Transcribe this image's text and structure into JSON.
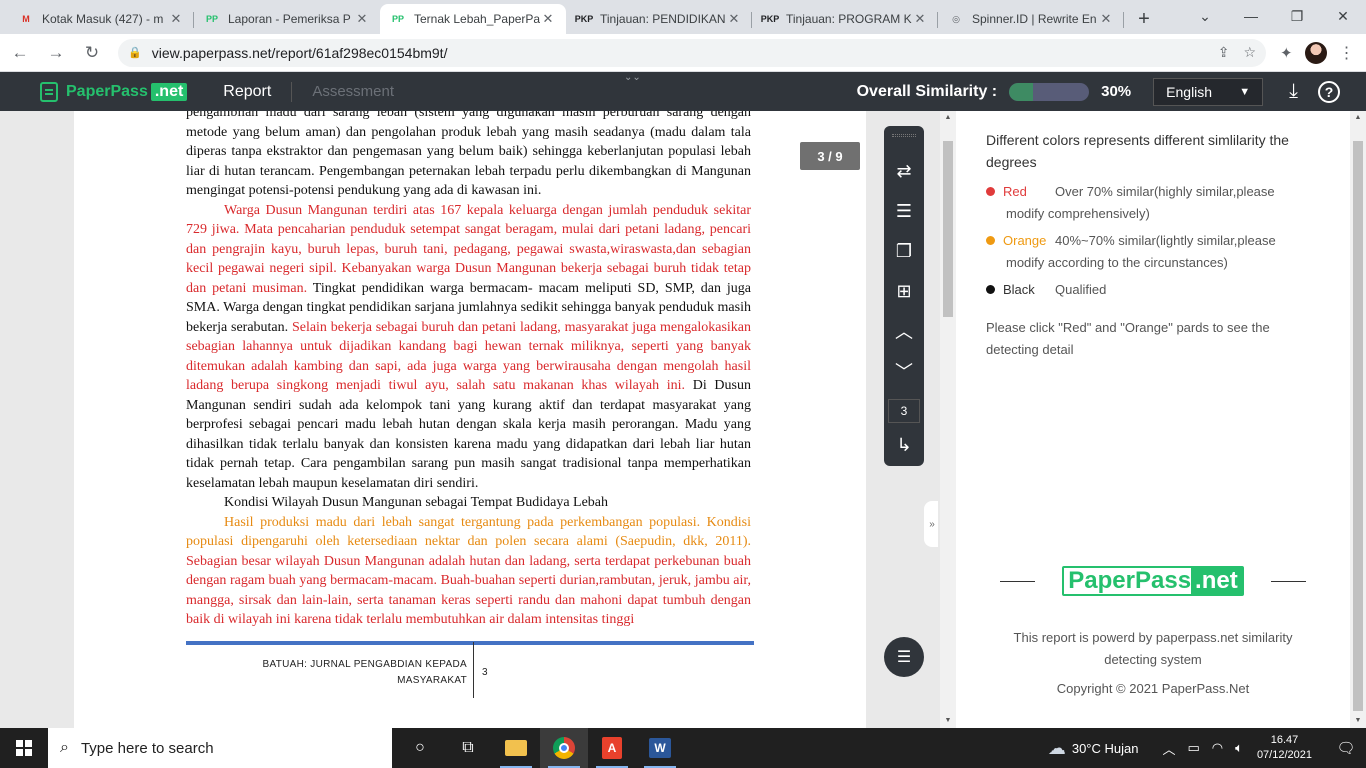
{
  "tabs": [
    {
      "icon": "M",
      "icon_color": "#d93025",
      "title": "Kotak Masuk (427) - m",
      "active": false
    },
    {
      "icon": "PP",
      "icon_color": "#25c06d",
      "title": "Laporan - Pemeriksa P",
      "active": false
    },
    {
      "icon": "PP",
      "icon_color": "#25c06d",
      "title": "Ternak Lebah_PaperPa",
      "active": true
    },
    {
      "icon": "PKP",
      "icon_color": "#202124",
      "title": "Tinjauan: PENDIDIKAN",
      "active": false
    },
    {
      "icon": "PKP",
      "icon_color": "#202124",
      "title": "Tinjauan: PROGRAM K",
      "active": false
    },
    {
      "icon": "◎",
      "icon_color": "#5f6368",
      "title": "Spinner.ID | Rewrite En",
      "active": false
    }
  ],
  "browser": {
    "url": "view.paperpass.net/report/61af298ec0154bm9t/"
  },
  "app": {
    "logo_text": "PaperPass",
    "logo_net": ".net",
    "nav_report": "Report",
    "nav_assessment": "Assessment",
    "overall_label": "Overall Similarity :",
    "similarity_pct": "30%",
    "similarity_value": 0.3,
    "language": "English"
  },
  "document": {
    "page_badge": "3 / 9",
    "p1_black_a": "pengambilan madu dari sarang lebah (sistem yang digunakan masih perburuan sarang dengan metode yang belum aman) dan pengolahan produk lebah yang masih seadanya (madu dalam tala diperas tanpa ekstraktor dan pengemasan yang belum baik) sehingga keberlanjutan populasi lebah liar di hutan terancam. Pengembangan peternakan lebah terpadu perlu dikembangkan di Mangunan mengingat potensi-potensi pendukung yang ada di kawasan ini.",
    "p2_red_a": "Warga Dusun Mangunan terdiri atas 167 kepala keluarga dengan jumlah penduduk sekitar 729 jiwa. Mata pencaharian penduduk setempat sangat beragam, mulai dari petani ladang, pencari dan pengrajin kayu, buruh lepas, buruh tani, pedagang, pegawai swasta,wiraswasta,dan sebagian kecil pegawai negeri sipil. Kebanyakan warga Dusun Mangunan bekerja sebagai buruh tidak tetap dan petani musiman.",
    "p2_black_b": " Tingkat pendidikan warga bermacam- macam meliputi SD, SMP, dan juga SMA. Warga dengan tingkat pendidikan sarjana jumlahnya sedikit sehingga banyak penduduk masih bekerja serabutan.",
    "p2_red_c": " Selain bekerja sebagai buruh dan petani ladang, masyarakat juga mengalokasikan sebagian lahannya untuk dijadikan kandang bagi hewan ternak miliknya, seperti yang banyak ditemukan adalah kambing dan sapi, ada juga warga yang berwirausaha dengan mengolah hasil ladang berupa singkong menjadi tiwul ayu, salah satu makanan khas wilayah ini.",
    "p2_black_d": " Di Dusun Mangunan sendiri sudah ada kelompok tani yang kurang aktif dan terdapat masyarakat yang berprofesi sebagai pencari madu lebah hutan dengan skala kerja masih perorangan. Madu yang dihasilkan tidak terlalu banyak dan konsisten karena madu yang didapatkan dari lebah liar hutan tidak pernah tetap. Cara pengambilan sarang pun masih sangat tradisional tanpa memperhatikan keselamatan lebah maupun keselamatan diri sendiri.",
    "subheading": "Kondisi Wilayah Dusun Mangunan sebagai Tempat Budidaya Lebah",
    "p3_orange_a": "Hasil produksi madu dari lebah sangat tergantung pada perkembangan populasi. Kondisi populasi dipengaruhi oleh ketersediaan nektar dan polen secara alami (Saepudin, dkk, 2011).",
    "p3_red_b": " Sebagian besar wilayah Dusun Mangunan adalah hutan dan ladang, serta terdapat perkebunan buah dengan ragam buah yang bermacam-macam. Buah-buahan seperti durian,rambutan, jeruk, jambu air, mangga, sirsak dan lain-lain, serta tanaman keras seperti randu dan mahoni dapat tumbuh dengan baik di wilayah ini karena tidak terlalu membutuhkan air dalam intensitas tinggi",
    "footer_journal_1": "BATUAH: JURNAL PENGABDIAN KEPADA",
    "footer_journal_2": "MASYARAKAT",
    "footer_page": "3"
  },
  "toolbar": {
    "page_input": "3"
  },
  "panel": {
    "title": "Different colors represents different simlilarity the degrees",
    "legend": [
      {
        "name": "Red",
        "color": "#e03b3b",
        "desc": "Over 70% similar(highly similar,please",
        "desc2": "modify comprehensively)"
      },
      {
        "name": "Orange",
        "color": "#ef9a12",
        "desc": "40%~70% similar(lightly similar,please",
        "desc2": "modify according to the circunstances)"
      },
      {
        "name": "Black",
        "color": "#111111",
        "desc": "Qualified",
        "desc2": ""
      }
    ],
    "click_hint": "Please click \"Red\" and \"Orange\" pards to see the detecting detail",
    "logo_text": "PaperPass",
    "logo_net": ".net",
    "powered": "This report is powerd by paperpass.net similarity detecting system",
    "copyright": "Copyright © 2021 PaperPass.Net"
  },
  "taskbar": {
    "search_placeholder": "Type here to search",
    "weather": "30°C  Hujan",
    "time": "16.47",
    "date": "07/12/2021"
  }
}
